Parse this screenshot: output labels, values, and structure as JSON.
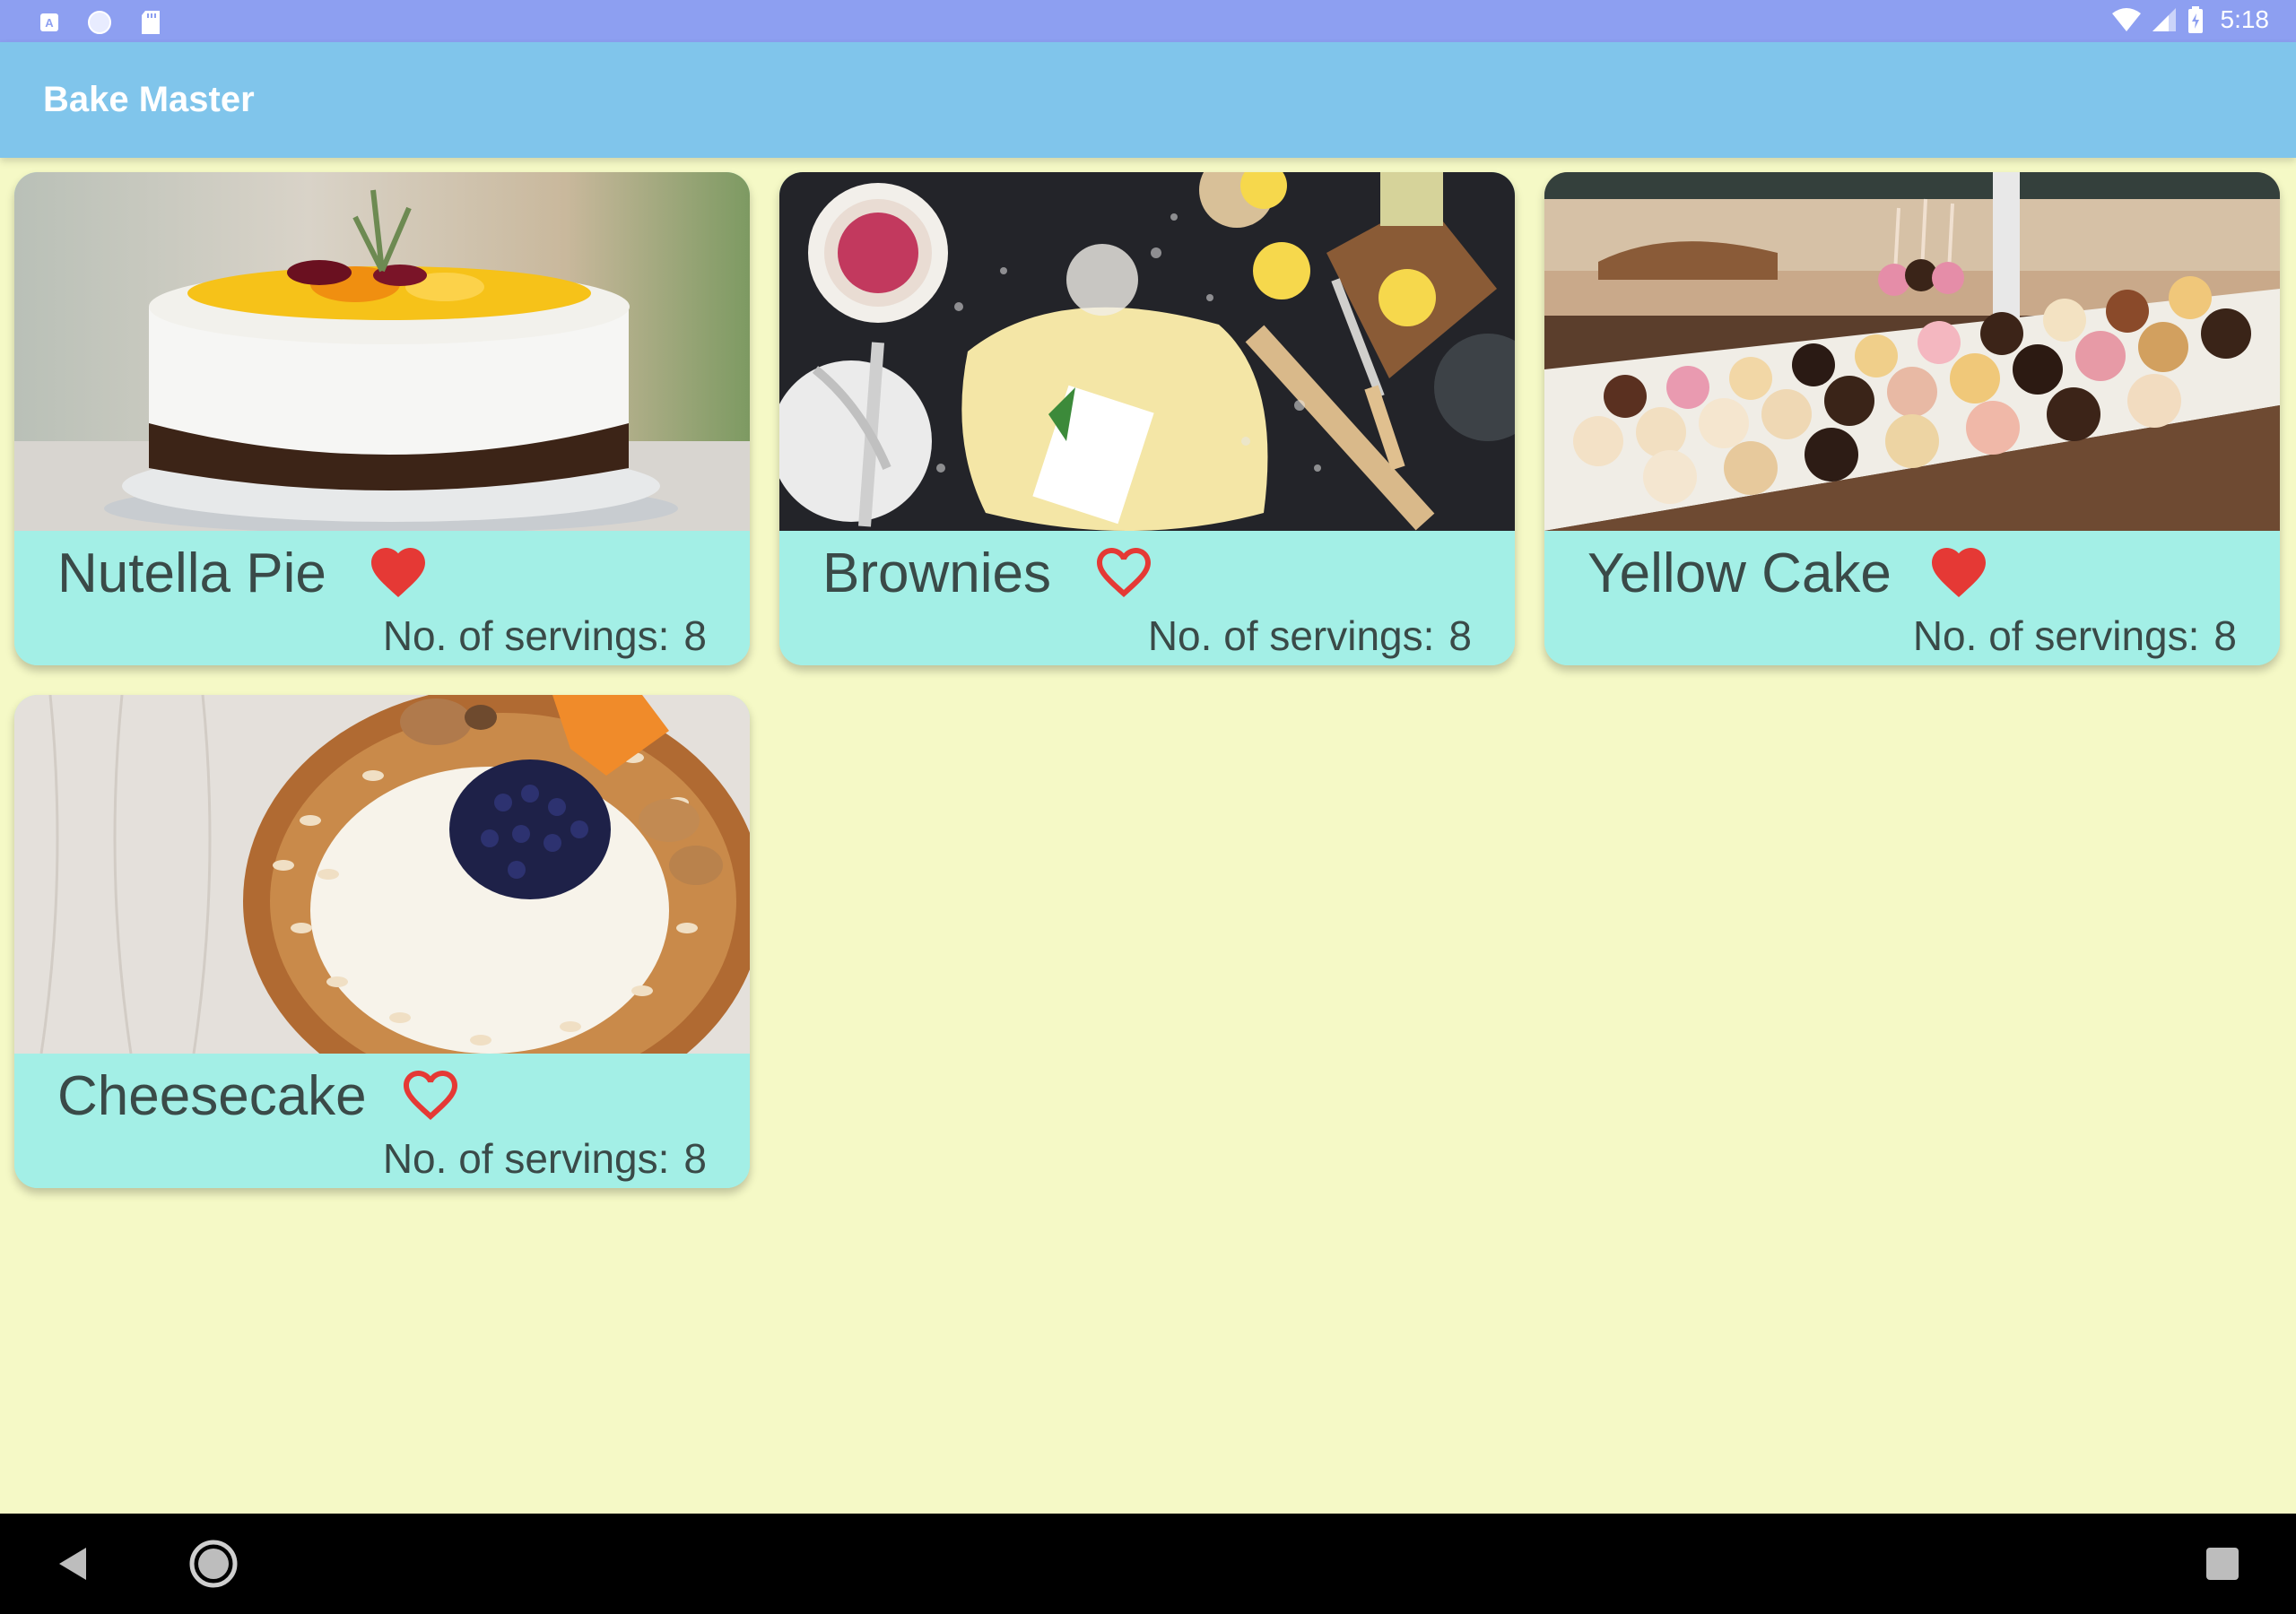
{
  "status_bar": {
    "time": "5:18",
    "left_icons": [
      "keyboard-a-icon",
      "sync-circle-icon",
      "sd-card-icon"
    ],
    "right_icons": [
      "wifi-icon",
      "cell-signal-icon",
      "battery-icon"
    ]
  },
  "app_bar": {
    "title": "Bake Master"
  },
  "recipes": [
    {
      "name": "Nutella Pie",
      "favorite": true,
      "servings_label": "No. of servings:",
      "servings": "8",
      "image": "cake-photo"
    },
    {
      "name": "Brownies",
      "favorite": false,
      "servings_label": "No. of servings:",
      "servings": "8",
      "image": "baking-table-photo"
    },
    {
      "name": "Yellow Cake",
      "favorite": true,
      "servings_label": "No. of servings:",
      "servings": "8",
      "image": "pastry-display-photo"
    },
    {
      "name": "Cheesecake",
      "favorite": false,
      "servings_label": "No. of servings:",
      "servings": "8",
      "image": "berry-tart-photo"
    }
  ],
  "colors": {
    "background": "#f5f9c6",
    "status_bar": "#8d9ff1",
    "app_bar": "#80c5eb",
    "card_footer": "#a3efe6",
    "heart": "#e53935",
    "nav_bar": "#000000"
  },
  "nav_bar": {
    "icons": [
      "back-icon",
      "home-icon",
      "recents-icon"
    ]
  }
}
